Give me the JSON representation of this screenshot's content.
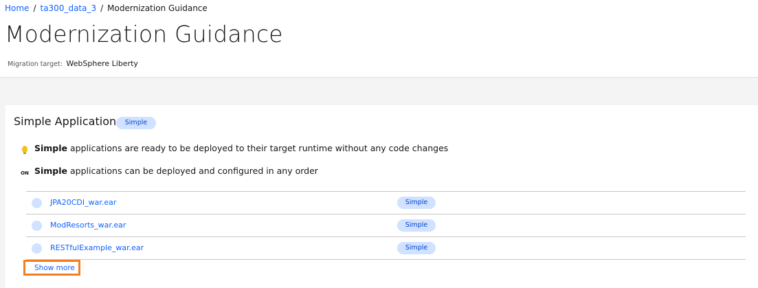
{
  "breadcrumb": {
    "home": "Home",
    "separator": "/",
    "project": "ta300_data_3",
    "current": "Modernization Guidance"
  },
  "page": {
    "title": "Modernization Guidance",
    "migration_target_label": "Migration target:",
    "migration_target_value": "WebSphere Liberty"
  },
  "section": {
    "title": "Simple Applications",
    "tag": "Simple",
    "notes": [
      {
        "icon": "lightbulb-icon",
        "bold": "Simple",
        "text": " applications are ready to be deployed to their target runtime without any code changes"
      },
      {
        "icon": "on-off-order-icon",
        "icon_text": "ON",
        "bold": "Simple",
        "text": " applications can be deployed and configured in any order"
      }
    ],
    "apps": [
      {
        "name": "JPA20CDI_war.ear",
        "tag": "Simple"
      },
      {
        "name": "ModResorts_war.ear",
        "tag": "Simple"
      },
      {
        "name": "RESTfulExample_war.ear",
        "tag": "Simple"
      }
    ],
    "show_more": "Show more"
  },
  "colors": {
    "link": "#0f62fe",
    "tag_bg": "#d0e2ff",
    "tag_text": "#0043ce",
    "highlight": "#f38020",
    "band": "#f4f4f4"
  }
}
